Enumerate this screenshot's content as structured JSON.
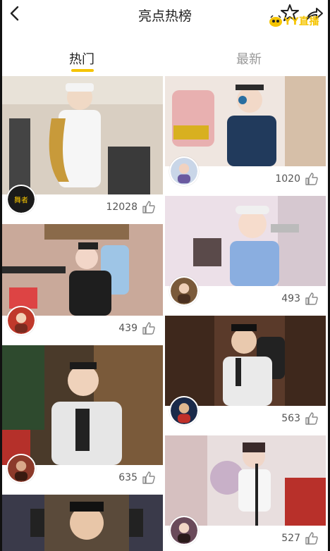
{
  "header": {
    "title": "亮点热榜",
    "watermark": "YY直播"
  },
  "tabs": [
    {
      "label": "热门",
      "active": true
    },
    {
      "label": "最新",
      "active": false
    }
  ],
  "left_column": [
    {
      "count": "12028",
      "avatar_label": "舞者"
    },
    {
      "count": "439"
    },
    {
      "count": "635"
    },
    {
      "count": ""
    }
  ],
  "right_column": [
    {
      "count": "1020"
    },
    {
      "count": "493"
    },
    {
      "count": "563"
    },
    {
      "count": "527"
    }
  ],
  "colors": {
    "accent": "#f5c400",
    "text_primary": "#222222",
    "text_secondary": "#999999",
    "count_text": "#555555"
  },
  "icons": [
    "back-arrow-icon",
    "star-icon",
    "share-icon",
    "like-icon"
  ]
}
